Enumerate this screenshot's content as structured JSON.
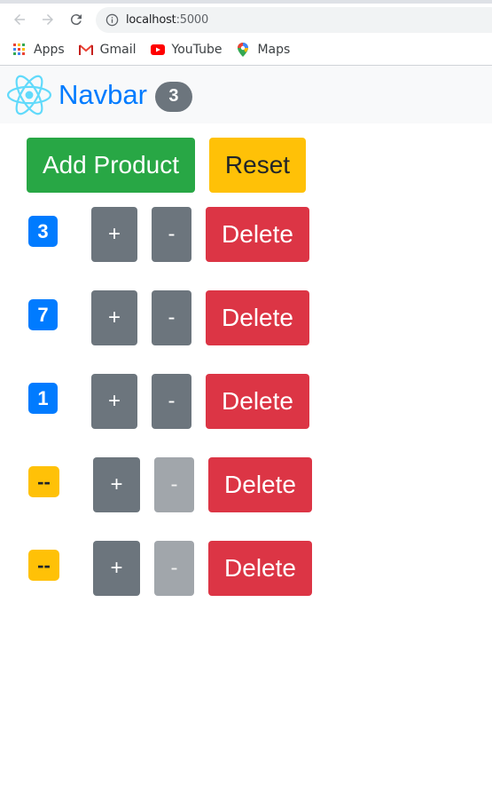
{
  "browser": {
    "url_host": "localhost",
    "url_port": ":5000",
    "bookmarks": [
      {
        "label": "Apps",
        "icon": "apps-grid-icon"
      },
      {
        "label": "Gmail",
        "icon": "gmail-icon"
      },
      {
        "label": "YouTube",
        "icon": "youtube-icon"
      },
      {
        "label": "Maps",
        "icon": "maps-pin-icon"
      }
    ]
  },
  "navbar": {
    "brand": "Navbar",
    "count": "3"
  },
  "actions": {
    "add_label": "Add Product",
    "reset_label": "Reset"
  },
  "counters": [
    {
      "value": "3",
      "variant": "primary",
      "increment_label": "+",
      "decrement_label": "-",
      "decrement_disabled": false,
      "delete_label": "Delete"
    },
    {
      "value": "7",
      "variant": "primary",
      "increment_label": "+",
      "decrement_label": "-",
      "decrement_disabled": false,
      "delete_label": "Delete"
    },
    {
      "value": "1",
      "variant": "primary",
      "increment_label": "+",
      "decrement_label": "-",
      "decrement_disabled": false,
      "delete_label": "Delete"
    },
    {
      "value": "--",
      "variant": "warning",
      "increment_label": "+",
      "decrement_label": "-",
      "decrement_disabled": true,
      "delete_label": "Delete"
    },
    {
      "value": "--",
      "variant": "warning",
      "increment_label": "+",
      "decrement_label": "-",
      "decrement_disabled": true,
      "delete_label": "Delete"
    }
  ],
  "colors": {
    "primary": "#007bff",
    "success": "#28a745",
    "warning": "#ffc107",
    "secondary": "#6c757d",
    "danger": "#dc3545",
    "react": "#61dafb"
  }
}
